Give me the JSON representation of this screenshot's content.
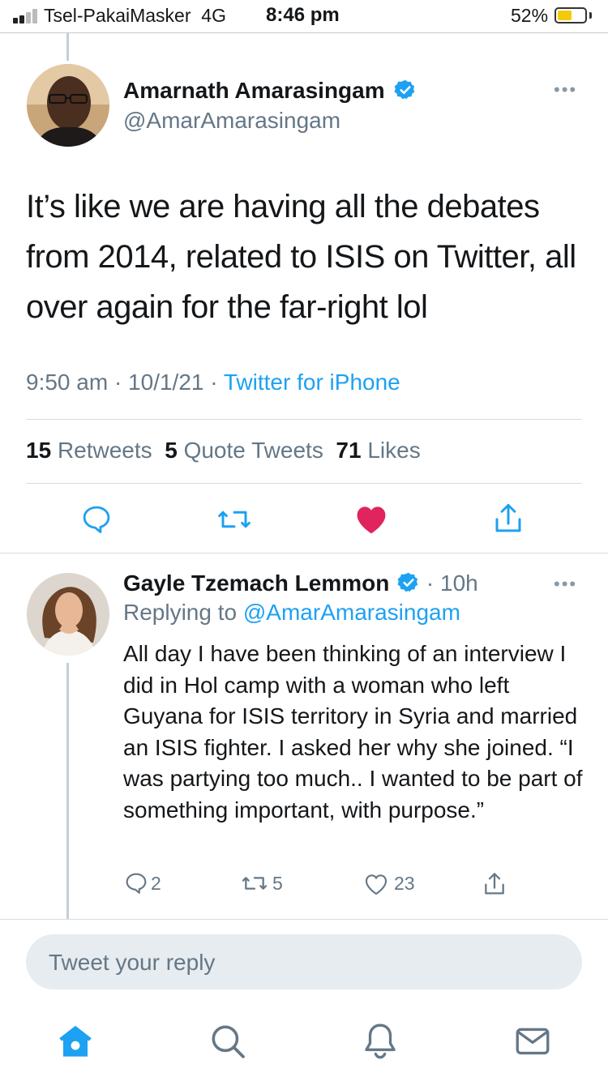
{
  "status_bar": {
    "carrier": "Tsel-PakaiMasker  4G",
    "time": "8:46 pm",
    "battery": "52%",
    "battery_level": 0.52,
    "battery_color": "#f3cb0a"
  },
  "main_tweet": {
    "author_name": "Amarnath Amarasingam",
    "author_handle": "@AmarAmarasingam",
    "verified_icon": "verified-badge-icon",
    "text": "It’s like we are having all the debates from 2014, related to ISIS on Twitter, all over again for the far-right lol",
    "time": "9:50 am · 10/1/21 · ",
    "source": "Twitter for iPhone",
    "stats": {
      "retweets_count": "15",
      "retweets_label": "Retweets",
      "quotes_count": "5",
      "quotes_label": "Quote Tweets",
      "likes_count": "71",
      "likes_label": "Likes"
    },
    "actions": [
      "reply-icon",
      "retweet-icon",
      "like-icon",
      "share-icon"
    ],
    "liked": true,
    "like_color": "#e0245e"
  },
  "reply_tweet": {
    "author_name": "Gayle Tzemach Lemmon",
    "time": "· 10h",
    "replying_prefix": "Replying to ",
    "replying_to": "@AmarAmarasingam",
    "text": "All day I have been thinking of an interview I did in Hol camp with a woman who left Guyana for ISIS territory in Syria and married an ISIS fighter. I asked her why she joined. “I was partying too much.. I wanted to be part of something important, with purpose.”",
    "reply_count": "2",
    "retweet_count": "5",
    "like_count": "23"
  },
  "composer": {
    "placeholder": "Tweet your reply"
  },
  "tab_bar": [
    "home-icon",
    "search-icon",
    "notifications-icon",
    "messages-icon"
  ],
  "accent_color": "#1da1f2",
  "verified_color": "#1da1f2"
}
